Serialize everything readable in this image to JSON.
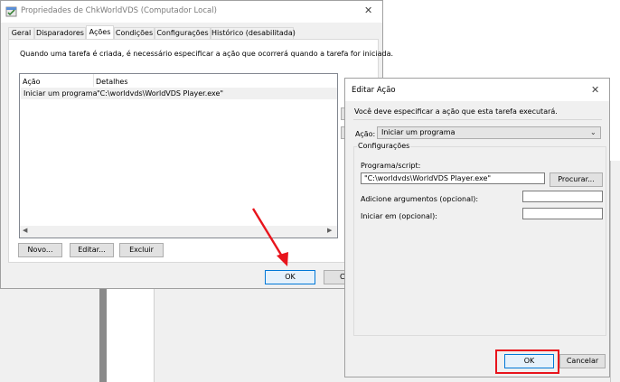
{
  "main_window": {
    "title": "Propriedades de ChkWorldVDS (Computador Local)",
    "close_glyph": "✕",
    "tabs": [
      "Geral",
      "Disparadores",
      "Ações",
      "Condições",
      "Configurações",
      "Histórico (desabilitada)"
    ],
    "active_tab_index": 2,
    "description": "Quando uma tarefa é criada, é necessário especificar a ação que ocorrerá quando a tarefa for iniciada.",
    "table": {
      "columns": [
        "Ação",
        "Detalhes"
      ],
      "rows": [
        {
          "action": "Iniciar um programa",
          "details": "\"C:\\worldvds\\WorldVDS Player.exe\""
        }
      ]
    },
    "buttons": {
      "new": "Novo...",
      "edit": "Editar...",
      "delete": "Excluir"
    },
    "ok_label": "OK",
    "cancel_label": "Canc"
  },
  "edit_dialog": {
    "title": "Editar Ação",
    "close_glyph": "✕",
    "instruction": "Você deve especificar a ação que esta tarefa executará.",
    "action_label": "Ação:",
    "action_value": "Iniciar um programa",
    "group_title": "Configurações",
    "program_label": "Programa/script:",
    "program_value": "\"C:\\worldvds\\WorldVDS Player.exe\"",
    "browse_label": "Procurar...",
    "args_label": "Adicione argumentos (opcional):",
    "args_value": "",
    "start_label": "Iniciar em (opcional):",
    "start_value": "",
    "ok_label": "OK",
    "cancel_label": "Cancelar"
  },
  "annotation_colors": {
    "arrow": "#e8141c",
    "highlight": "#e8141c"
  }
}
